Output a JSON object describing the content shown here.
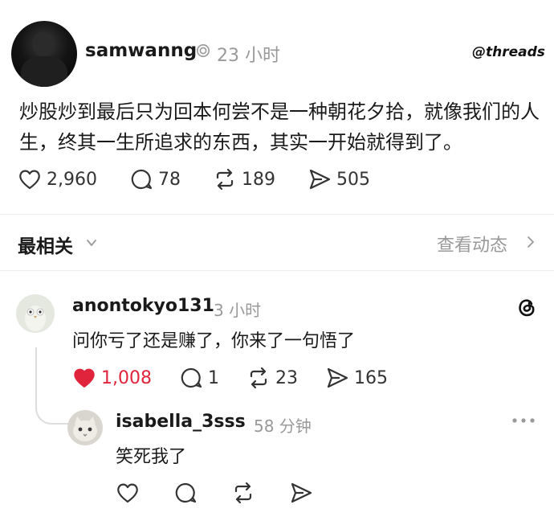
{
  "post": {
    "username": "samwanng",
    "time": "23 小时",
    "brand": "threads",
    "text": "炒股炒到最后只为回本何尝不是一种朝花夕拾，就像我们的人生，终其一生所追求的东西，其实一开始就得到了。",
    "likes": "2,960",
    "replies": "78",
    "reposts": "189",
    "shares": "505"
  },
  "sort": {
    "label": "最相关",
    "activity_link": "查看动态"
  },
  "comments": [
    {
      "username": "anontokyo131",
      "time": "3 小时",
      "text": "问你亏了还是赚了，你来了一句悟了",
      "likes": "1,008",
      "replies": "1",
      "reposts": "23",
      "shares": "165",
      "liked": true
    },
    {
      "username": "isabella_3sss",
      "time": "58 分钟",
      "text": "笑死我了"
    }
  ],
  "colors": {
    "liked_red": "#e0243b",
    "muted_gray": "#999999",
    "text": "#1a1a1a"
  }
}
